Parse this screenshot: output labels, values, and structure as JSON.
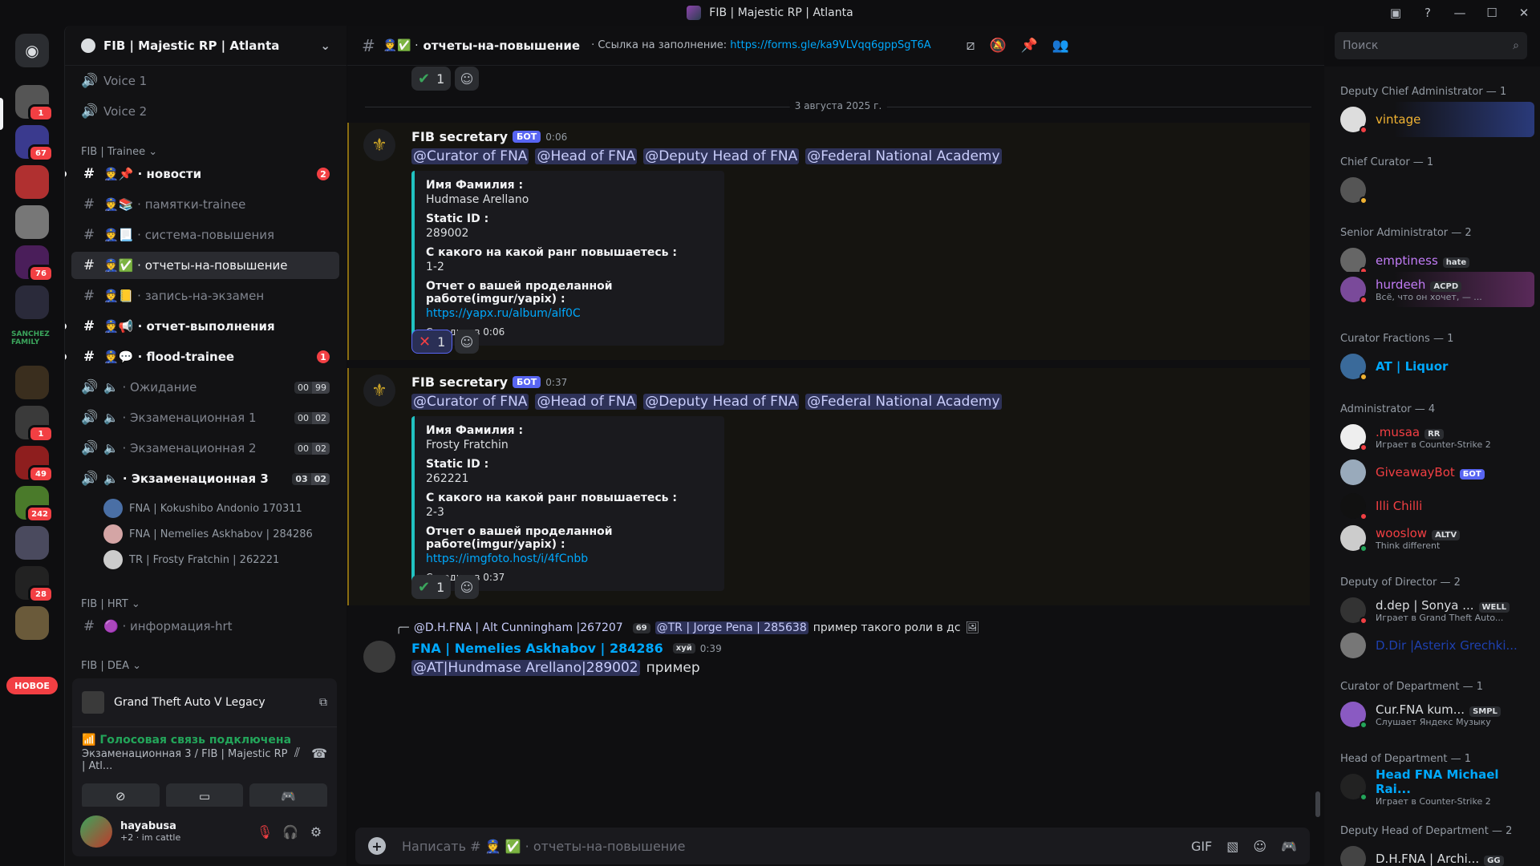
{
  "window": {
    "title": "FIB | Majestic RP | Atlanta"
  },
  "guilds": {
    "new_label": "НОВОЕ",
    "badges": [
      "1",
      "67",
      "76",
      "1",
      "49",
      "242",
      "28"
    ],
    "sanchez_label": "SANCHEZ FAMILY"
  },
  "server": {
    "name": "FIB | Majestic RP | Atlanta"
  },
  "channels": {
    "voice_top": [
      {
        "name": "Voice 1"
      },
      {
        "name": "Voice 2"
      }
    ],
    "category_trainee": "FIB | Trainee",
    "text": [
      {
        "name": "новости",
        "emoji": "📌",
        "badge": "2"
      },
      {
        "name": "памятки-trainee",
        "emoji": "📚"
      },
      {
        "name": "система-повышения",
        "emoji": "📃"
      },
      {
        "name": "отчеты-на-повышение",
        "emoji": "✅"
      },
      {
        "name": "запись-на-экзамен",
        "emoji": "📒"
      },
      {
        "name": "отчет-выполнения",
        "emoji": "📢"
      },
      {
        "name": "flood-trainee",
        "emoji": "💬",
        "badge": "1"
      }
    ],
    "voice": [
      {
        "name": "Ожидание",
        "c1": "00",
        "c2": "99"
      },
      {
        "name": "Экзаменационная 1",
        "c1": "00",
        "c2": "02"
      },
      {
        "name": "Экзаменационная 2",
        "c1": "00",
        "c2": "02"
      },
      {
        "name": "Экзаменационная 3",
        "c1": "03",
        "c2": "02"
      }
    ],
    "voice_users": [
      {
        "name": "FNA | Kokushibo Andonio 170311"
      },
      {
        "name": "FNA | Nemelies Askhabov | 284286"
      },
      {
        "name": "TR | Frosty Fratchin | 262221"
      }
    ],
    "category_hrt": "FIB | HRT",
    "hrt_channel": "информация-hrt",
    "category_dea": "FIB | DEA"
  },
  "activity": {
    "game": "Grand Theft Auto V Legacy"
  },
  "voice_panel": {
    "status": "Голосовая связь подключена",
    "channel": "Экзаменационная 3 / FIB | Majestic RP | Atl..."
  },
  "user": {
    "name": "hayabusa",
    "status": "+2 · im cattle"
  },
  "header": {
    "channel": "отчеты-на-повышение",
    "topic_label": "Ссылка на заполнение:",
    "topic_link": "https://forms.gle/ka9VLVqq6gppSgT6A",
    "search_placeholder": "Поиск"
  },
  "messages": {
    "date_divider": "3 августа 2025 г.",
    "top_reaction_count": "1",
    "posts": [
      {
        "author": "FIB secretary",
        "bot": "БОТ",
        "time": "0:06",
        "mentions": [
          "@Curator of FNA",
          "@Head of FNA",
          "@Deputy Head of FNA",
          "@Federal National Academy"
        ],
        "fields": [
          {
            "name": "Имя Фамилия :",
            "value": "Hudmase Arellano"
          },
          {
            "name": "Static ID :",
            "value": "289002"
          },
          {
            "name": "С какого на какой ранг повышаетесь :",
            "value": "1-2"
          },
          {
            "name": "Отчет о вашей проделанной работе(imgur/yapix) :",
            "value": "https://yapx.ru/album/alf0C"
          }
        ],
        "footer": "Сегодня, в 0:06",
        "reaction_count": "1"
      },
      {
        "author": "FIB secretary",
        "bot": "БОТ",
        "time": "0:37",
        "mentions": [
          "@Curator of FNA",
          "@Head of FNA",
          "@Deputy Head of FNA",
          "@Federal National Academy"
        ],
        "fields": [
          {
            "name": "Имя Фамилия :",
            "value": "Frosty Fratchin"
          },
          {
            "name": "Static ID :",
            "value": "262221"
          },
          {
            "name": "С какого на какой ранг повышаетесь :",
            "value": "2-3"
          },
          {
            "name": "Отчет о вашей проделанной работе(imgur/yapix) :",
            "value": "https://imgfoto.host/i/4fCnbb"
          }
        ],
        "footer": "Сегодня, в 0:37",
        "reaction_count": "1"
      }
    ],
    "reply": {
      "ref_author": "@D.H.FNA | Alt Cunningham |267207",
      "ref_tag": "69",
      "ref_mention": "@TR | Jorge Pena | 285638",
      "ref_text": "пример такого роли в дс",
      "author": "FNA | Nemelies Askhabov | 284286",
      "author_tag": "хуй",
      "time": "0:39",
      "mention": "@AT|Hundmase Arellano|289002",
      "text": "пример"
    }
  },
  "input": {
    "placeholder": "Написать # 👮 ✅ · отчеты-на-повышение"
  },
  "members": {
    "groups": [
      {
        "title": "Deputy Chief Administrator — 1"
      },
      {
        "title": "Chief Curator — 1"
      },
      {
        "title": "Senior Administrator — 2"
      },
      {
        "title": "Curator Fractions — 1"
      },
      {
        "title": "Administrator — 4"
      },
      {
        "title": "Deputy of Director — 2"
      },
      {
        "title": "Curator of Department — 1"
      },
      {
        "title": "Head of Department — 1"
      },
      {
        "title": "Deputy Head of Department — 2"
      }
    ],
    "list": [
      {
        "name": "vintage",
        "color": "#f0b232"
      },
      {
        "name": "",
        "color": "#4e5058"
      },
      {
        "name": "emptiness",
        "color": "#c27cf7",
        "tag": "hate"
      },
      {
        "name": "hurdeeh",
        "color": "#c27cf7",
        "tag": "ACPD",
        "sub": "Всё, что он хочет, — ..."
      },
      {
        "name": "AT | Liquor",
        "color": "#00a8fc"
      },
      {
        "name": ".musaa",
        "color": "#f23f43",
        "tag": "RR",
        "sub": "Играет в Counter-Strike 2"
      },
      {
        "name": "GiveawayBot",
        "color": "#f23f43",
        "tag": "БОТ"
      },
      {
        "name": "Illi Chilli",
        "color": "#f23f43"
      },
      {
        "name": "wooslow",
        "color": "#f23f43",
        "tag": "ALTV",
        "sub": "Think different"
      },
      {
        "name": "d.dep | Sonya ...",
        "color": "#dbdee1",
        "tag": "WELL",
        "sub": "Играет в Grand Theft Auto..."
      },
      {
        "name": "D.Dir |Asterix Grechki...",
        "color": "#1e40af"
      },
      {
        "name": "Cur.FNA kum...",
        "color": "#dbdee1",
        "tag": "SMPL",
        "sub": "Слушает Яндекс Музыку"
      },
      {
        "name": "Head FNA Michael Rai...",
        "color": "#00a8fc",
        "sub": "Играет в Counter-Strike 2"
      },
      {
        "name": "D.H.FNA | Archi...",
        "color": "#dbdee1",
        "tag": "GG"
      }
    ]
  }
}
